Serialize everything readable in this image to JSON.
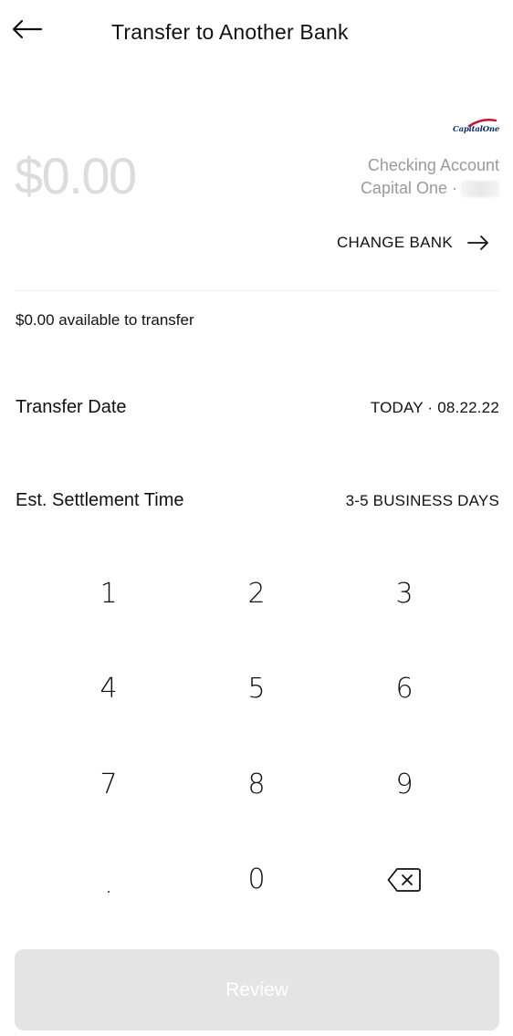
{
  "header": {
    "back_icon": "arrow-left-icon",
    "title": "Transfer to Another Bank"
  },
  "logo": {
    "text": "CapitalOne",
    "accent_color": "#c8102e",
    "brand_color": "#0c2d6b"
  },
  "amount": {
    "value": "$0.00",
    "color": "#dcdcdc"
  },
  "account": {
    "type": "Checking Account",
    "bank": "Capital One ·"
  },
  "change_bank": {
    "label": "CHANGE BANK",
    "icon": "arrow-right-icon"
  },
  "available": "$0.00 available to transfer",
  "transfer_date": {
    "label": "Transfer Date",
    "value": "TODAY · 08.22.22"
  },
  "settlement": {
    "label": "Est. Settlement Time",
    "value": "3-5 BUSINESS DAYS"
  },
  "keypad": {
    "k1": "1",
    "k2": "2",
    "k3": "3",
    "k4": "4",
    "k5": "5",
    "k6": "6",
    "k7": "7",
    "k8": "8",
    "k9": "9",
    "kdot": ".",
    "k0": "0",
    "backspace_icon": "backspace-icon"
  },
  "review_button": {
    "label": "Review",
    "background": "#e4e4e4"
  }
}
